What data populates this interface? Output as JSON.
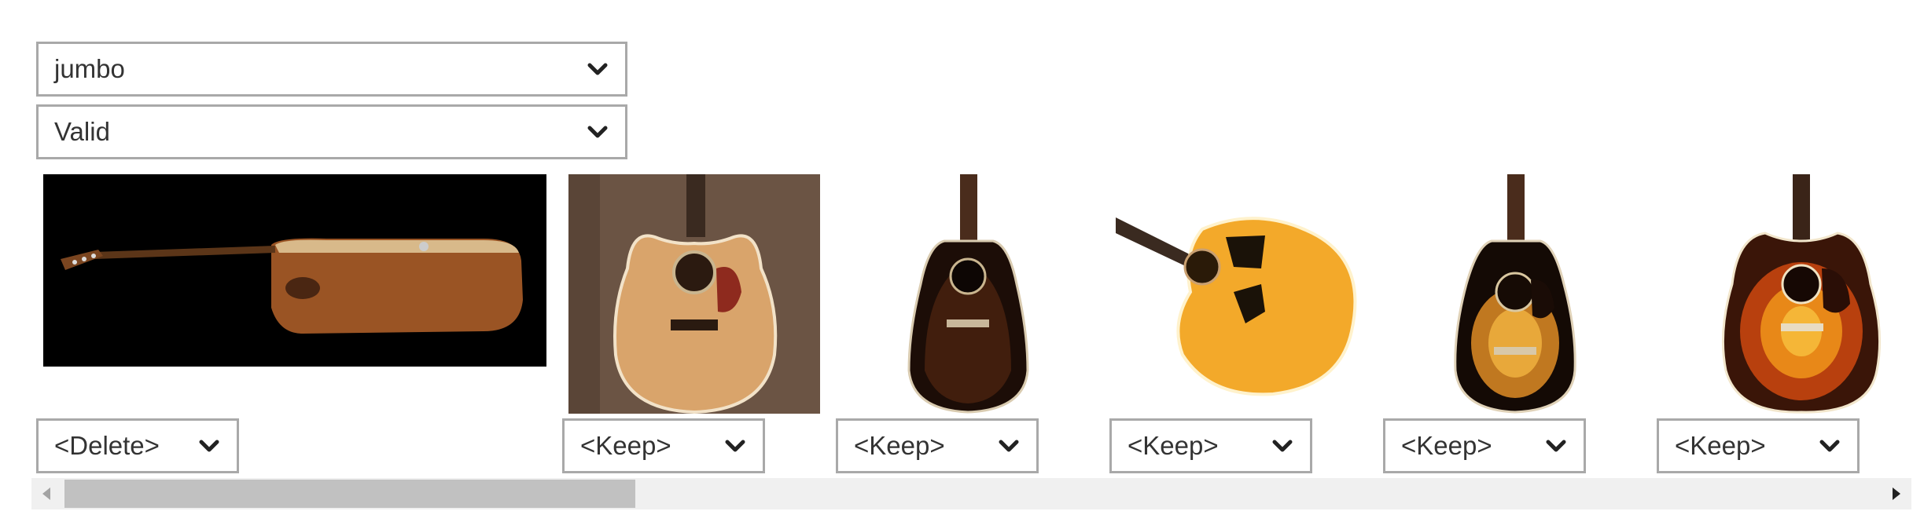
{
  "filters": {
    "category": "jumbo",
    "status": "Valid"
  },
  "items": [
    {
      "action": "<Delete>",
      "image": "guitar-side-view-koa"
    },
    {
      "action": "<Keep>",
      "image": "guitar-natural-cutaway-12-string"
    },
    {
      "action": "<Keep>",
      "image": "guitar-dark-sunburst-slope-shoulder"
    },
    {
      "action": "<Keep>",
      "image": "guitar-amber-jumbo-angled"
    },
    {
      "action": "<Keep>",
      "image": "guitar-sunburst-slope-shoulder"
    },
    {
      "action": "<Keep>",
      "image": "guitar-sunburst-jumbo"
    }
  ],
  "colors": {
    "border": "#a9a9a9",
    "scrollbar_track": "#f0f0f0",
    "scrollbar_thumb": "#c1c1c1"
  }
}
